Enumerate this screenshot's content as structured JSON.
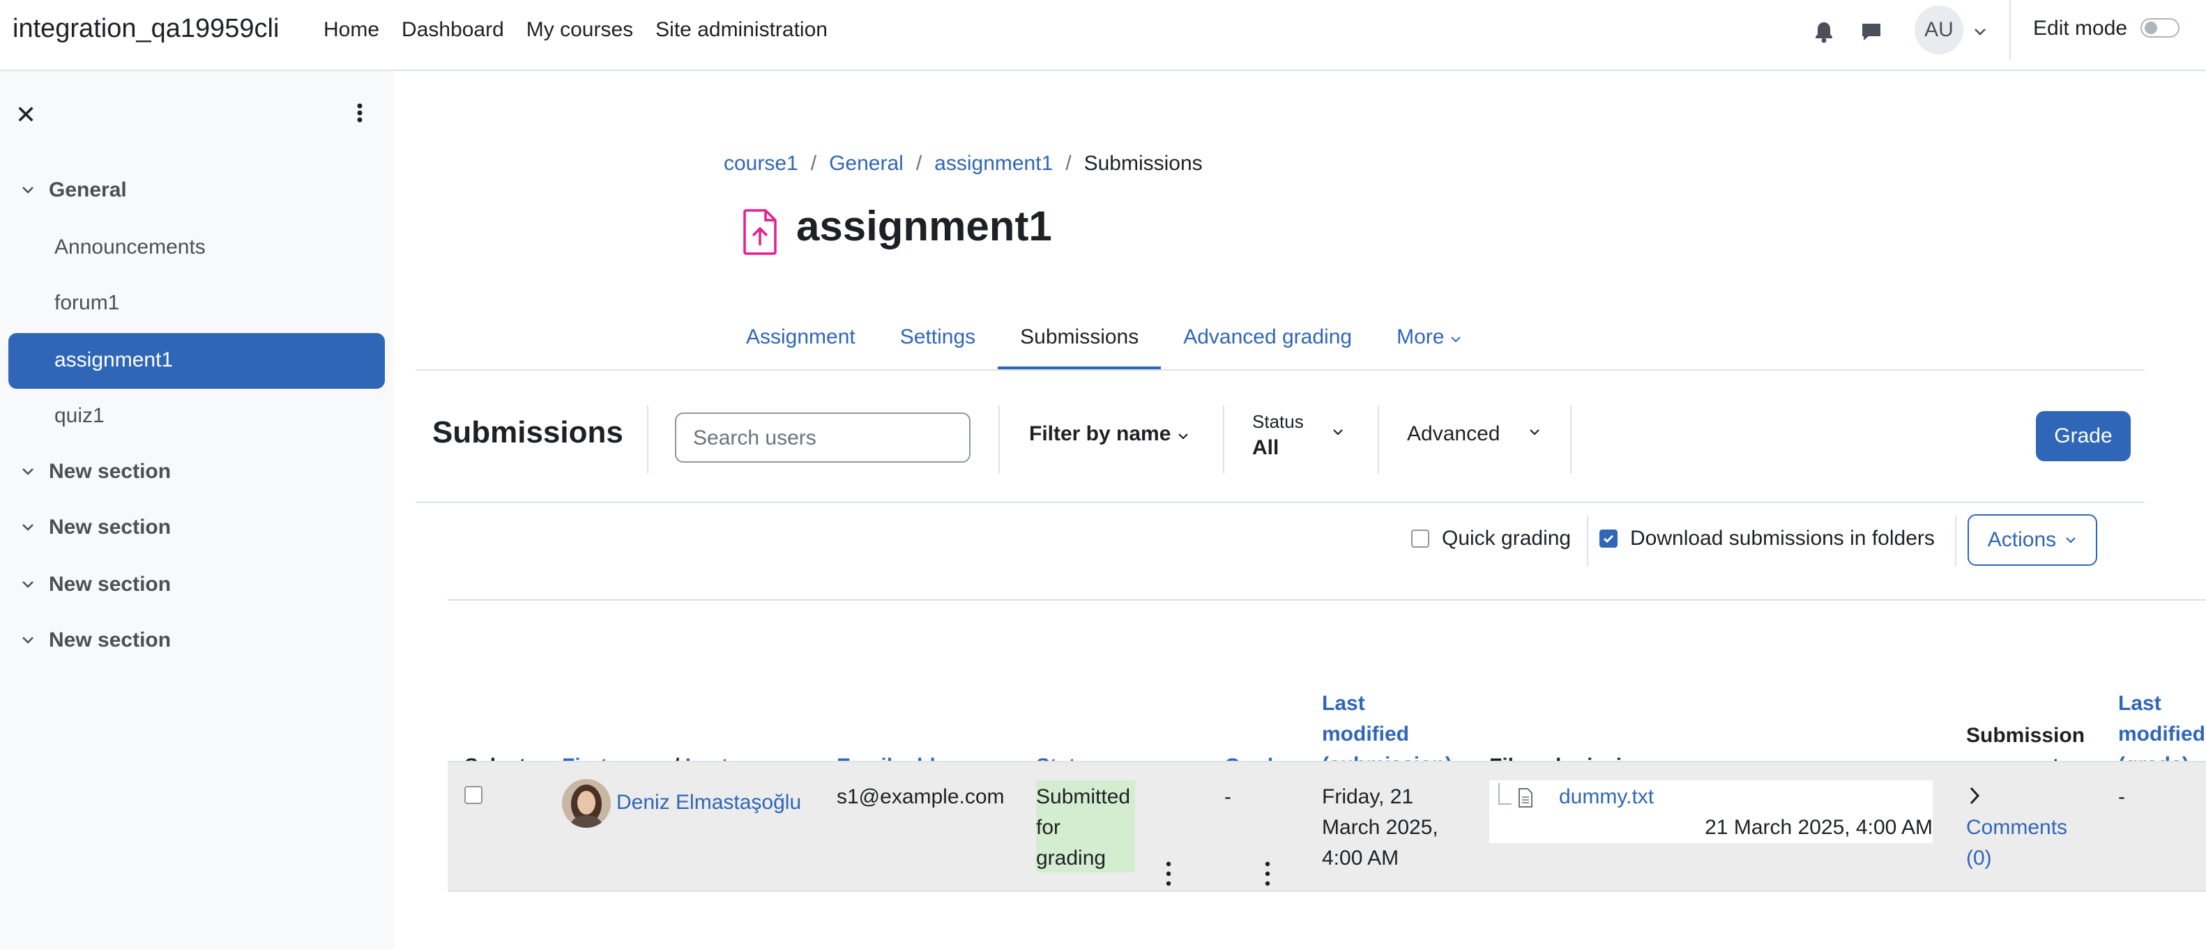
{
  "site_name": "integration_qa19959cli",
  "topnav": [
    "Home",
    "Dashboard",
    "My courses",
    "Site administration"
  ],
  "user_initials": "AU",
  "edit_mode_label": "Edit mode",
  "drawer": {
    "sections": [
      {
        "label": "General",
        "items": [
          "Announcements",
          "forum1",
          "assignment1",
          "quiz1"
        ]
      },
      {
        "label": "New section"
      },
      {
        "label": "New section"
      },
      {
        "label": "New section"
      },
      {
        "label": "New section"
      }
    ],
    "active_item": "assignment1"
  },
  "breadcrumb": [
    "course1",
    "General",
    "assignment1",
    "Submissions"
  ],
  "page_title": "assignment1",
  "tabs": [
    "Assignment",
    "Settings",
    "Submissions",
    "Advanced grading",
    "More"
  ],
  "active_tab": "Submissions",
  "toolbar": {
    "title": "Submissions",
    "search_placeholder": "Search users",
    "filter_by_name": "Filter by name",
    "status_label": "Status",
    "status_value": "All",
    "advanced": "Advanced",
    "grade_button": "Grade"
  },
  "options": {
    "quick_grading": "Quick grading",
    "download_in_folders": "Download submissions in folders",
    "actions": "Actions"
  },
  "table": {
    "headers": {
      "select": "Select",
      "first_name": "First name",
      "name_sep": "/",
      "last_name": "Last name",
      "email": "Email address",
      "status": "Status",
      "grade": "Grade",
      "last_modified_submission": [
        "Last",
        "modified",
        "(submission)"
      ],
      "file_submissions": "File submissions",
      "submission_comments": [
        "Submission",
        "comments"
      ],
      "last_modified_grade": [
        "Last",
        "modified",
        "(grade)"
      ]
    },
    "rows": [
      {
        "name": "Deniz Elmastaşoğlu",
        "email": "s1@example.com",
        "status": [
          "Submitted",
          "for",
          "grading"
        ],
        "grade": "-",
        "last_modified": [
          "Friday, 21",
          "March 2025,",
          "4:00 AM"
        ],
        "file_name": "dummy.txt",
        "file_date": "21 March 2025, 4:00 AM",
        "comments": [
          "Comments",
          "(0)"
        ],
        "last_modified_grade": "-"
      }
    ]
  },
  "colors": {
    "link": "#2f66b8",
    "active_nav": "#2f66b8",
    "status_chip": "#d4edd0",
    "assign_icon": "#e91e8c"
  }
}
